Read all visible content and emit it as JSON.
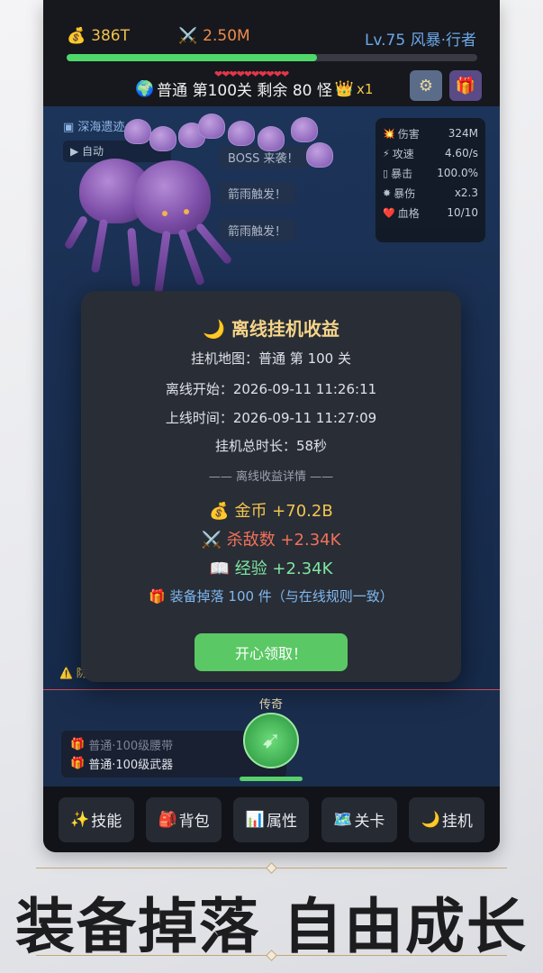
{
  "topbar": {
    "gold": "386T",
    "gold_icon": "💰",
    "power": "2.50M",
    "power_icon": "⚔️",
    "level": "Lv.75 风暴·行者",
    "xp_progress": 0.61,
    "stage_icon": "🌍",
    "stage_text": "普通 第100关  剩余 80 怪",
    "crown_icon": "👑",
    "multiplier": "x1",
    "settings_icon": "gear-icon",
    "gift_icon": "gift-icon"
  },
  "scene": {
    "zone_name": "深海遗迹",
    "auto_chip": "自动",
    "log": [
      "BOSS 来袭！",
      "箭雨触发！",
      "箭雨触发！"
    ],
    "stats": [
      {
        "icon": "💥",
        "label": "伤害",
        "value": "324M"
      },
      {
        "icon": "⚡",
        "label": "攻速",
        "value": "4.60/s"
      },
      {
        "icon": "▯",
        "label": "暴击",
        "value": "100.0%"
      },
      {
        "icon": "✸",
        "label": "暴伤",
        "value": "x2.3"
      },
      {
        "icon": "❤️",
        "label": "血格",
        "value": "10/10"
      }
    ],
    "warning_icon": "⚠️",
    "warning_text": "防"
  },
  "lower": {
    "legend_label": "传奇",
    "drops": [
      {
        "icon": "🎁",
        "text": "普通·100级腰带"
      },
      {
        "icon": "🎁",
        "text": "普通·100级武器"
      }
    ]
  },
  "modal": {
    "title": "🌙 离线挂机收益",
    "map": "挂机地图：普通 第 100 关",
    "start": "离线开始：2026-09-11 11:26:11",
    "online": "上线时间：2026-09-11 11:27:09",
    "duration": "挂机总时长：58秒",
    "divider": "—— 离线收益详情 ——",
    "gold": "💰 金币 +70.2B",
    "kills": "⚔️ 杀敌数 +2.34K",
    "exp": "📖 经验 +2.34K",
    "equip": "🎁 装备掉落 100 件（与在线规则一致）",
    "claim": "开心领取！"
  },
  "nav": [
    {
      "icon": "✨",
      "label": "技能"
    },
    {
      "icon": "🎒",
      "label": "背包"
    },
    {
      "icon": "📊",
      "label": "属性"
    },
    {
      "icon": "🗺️",
      "label": "关卡"
    },
    {
      "icon": "🌙",
      "label": "挂机"
    }
  ],
  "banner": {
    "text": "装备掉落 自由成长"
  }
}
